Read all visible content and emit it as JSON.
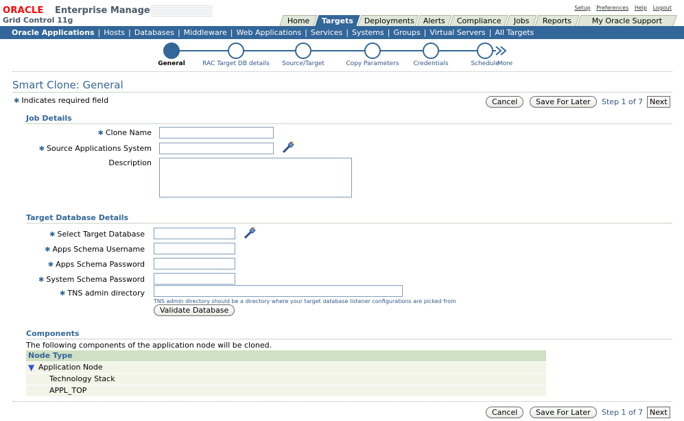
{
  "header": {
    "brand_oracle": "ORACLE",
    "brand_product": "Enterprise Manager",
    "brand_sub": "Grid Control 11g",
    "global_links": [
      "Setup",
      "Preferences",
      "Help",
      "Logout"
    ]
  },
  "tabs": [
    {
      "label": "Home",
      "active": false
    },
    {
      "label": "Targets",
      "active": true
    },
    {
      "label": "Deployments",
      "active": false
    },
    {
      "label": "Alerts",
      "active": false
    },
    {
      "label": "Compliance",
      "active": false
    },
    {
      "label": "Jobs",
      "active": false
    },
    {
      "label": "Reports",
      "active": false
    },
    {
      "label": "My Oracle Support",
      "active": false
    }
  ],
  "subnav": [
    {
      "label": "Oracle Applications",
      "active": true
    },
    {
      "label": "Hosts"
    },
    {
      "label": "Databases"
    },
    {
      "label": "Middleware"
    },
    {
      "label": "Web Applications"
    },
    {
      "label": "Services"
    },
    {
      "label": "Systems"
    },
    {
      "label": "Groups"
    },
    {
      "label": "Virtual Servers"
    },
    {
      "label": "All Targets"
    }
  ],
  "train": {
    "steps": [
      "General",
      "RAC Target DB details",
      "Source/Target",
      "Copy Parameters",
      "Credentials",
      "Schedule"
    ],
    "more_label": "More",
    "current_index": 0
  },
  "page": {
    "title": "Smart Clone: General",
    "required_note": "Indicates required field",
    "buttons": {
      "cancel": "Cancel",
      "save_later": "Save For Later",
      "step_text": "Step 1 of 7",
      "next": "Next"
    }
  },
  "job_details": {
    "heading": "Job Details",
    "clone_name_label": "Clone Name",
    "clone_name_value": "",
    "source_system_label": "Source Applications System",
    "source_system_value": "",
    "description_label": "Description",
    "description_value": ""
  },
  "target_db": {
    "heading": "Target Database Details",
    "select_db_label": "Select Target Database",
    "apps_user_label": "Apps Schema Username",
    "apps_pwd_label": "Apps Schema Password",
    "system_pwd_label": "System Schema Password",
    "tns_label": "TNS admin directory",
    "tns_hint": "TNS admin directory should be a directory where your target database listener configurations are picked from",
    "validate_button": "Validate Database"
  },
  "components": {
    "heading": "Components",
    "intro": "The following components of the application node will be cloned.",
    "column_header": "Node Type",
    "rows": [
      {
        "label": "Application Node",
        "expanded": true
      },
      {
        "label": "Technology Stack"
      },
      {
        "label": "APPL_TOP"
      }
    ]
  },
  "colors": {
    "brand_blue": "#336699",
    "oracle_red": "#ff0000",
    "tab_inactive": "#dfe7d8",
    "table_header": "#cfe0c3",
    "table_row": "#f2f4e8"
  }
}
